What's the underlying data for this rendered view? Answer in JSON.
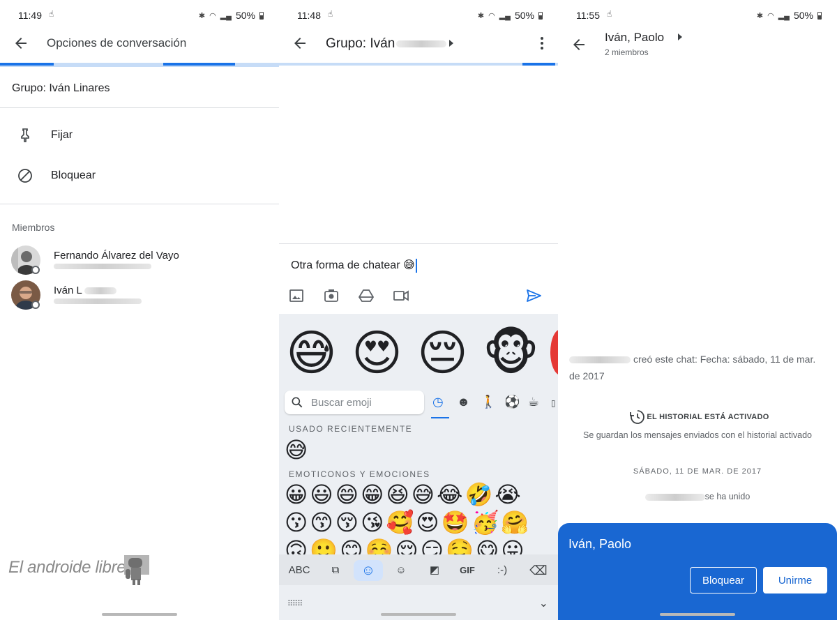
{
  "panel1": {
    "status": {
      "time": "11:49",
      "battery": "50%"
    },
    "title": "Opciones de conversación",
    "group_name": "Grupo: Iván Linares",
    "options": [
      {
        "label": "Fijar",
        "icon": "pin-icon"
      },
      {
        "label": "Bloquear",
        "icon": "block-icon"
      }
    ],
    "members_title": "Miembros",
    "members": [
      {
        "name": "Fernando Álvarez del Vayo"
      },
      {
        "name": "Iván L"
      }
    ],
    "watermark": "El androide libre"
  },
  "panel2": {
    "status": {
      "time": "11:48",
      "battery": "50%"
    },
    "title": "Grupo: Iván",
    "compose_text": "Otra forma de chatear 😅",
    "search_placeholder": "Buscar emoji",
    "section_recent": "USADO RECIENTEMENTE",
    "section_emotions": "EMOTICONOS Y EMOCIONES",
    "big_emojis": [
      "😅",
      "😍",
      "😔",
      "🐵"
    ],
    "recent_emojis": "😅",
    "emoji_row1": "😀😃😄😁😆😅😂🤣😭",
    "emoji_row2": "😗😙😚😘🥰😍🤩🥳🤗",
    "emoji_row3": "🙃🙂😊☺️😌😏🤤😋😛",
    "kb_keys": {
      "abc": "ABC",
      "gif": "GIF",
      "emoticon": ":-)"
    }
  },
  "panel3": {
    "status": {
      "time": "11:55",
      "battery": "50%"
    },
    "title": "Iván, Paolo",
    "subtitle": "2 miembros",
    "created_text": "creó este chat: Fecha: sábado, 11 de mar. de 2017",
    "history_title": "EL HISTORIAL ESTÁ ACTIVADO",
    "history_sub": "Se guardan los mensajes enviados con el historial activado",
    "date_label": "SÁBADO, 11 DE MAR. DE 2017",
    "joined_text": "se ha unido",
    "invite": {
      "title": "Iván, Paolo",
      "block_label": "Bloquear",
      "join_label": "Unirme"
    }
  },
  "colors": {
    "accent": "#1a73e8",
    "invite_bg": "#1967d2",
    "keyboard_bg": "#eceff3"
  }
}
